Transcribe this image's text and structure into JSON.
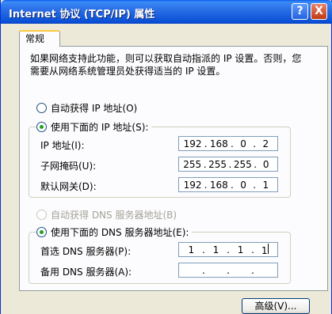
{
  "window": {
    "title": "Internet 协议 (TCP/IP) 属性",
    "help_label": "?",
    "close_label": "X"
  },
  "tabs": [
    {
      "label": "常规"
    }
  ],
  "description": "如果网络支持此功能，则可以获取自动指派的 IP 设置。否则，您需要从网络系统管理员处获得适当的 IP 设置。",
  "ip_mode": {
    "auto_label": "自动获得 IP 地址(O)",
    "manual_label": "使用下面的 IP 地址(S):",
    "selected": "manual"
  },
  "ip_fields": {
    "ip_label": "IP 地址(I):",
    "ip": [
      "192",
      "168",
      "0",
      "2"
    ],
    "mask_label": "子网掩码(U):",
    "mask": [
      "255",
      "255",
      "255",
      "0"
    ],
    "gateway_label": "默认网关(D):",
    "gateway": [
      "192",
      "168",
      "0",
      "1"
    ]
  },
  "dns_mode": {
    "auto_label": "自动获得 DNS 服务器地址(B)",
    "manual_label": "使用下面的 DNS 服务器地址(E):",
    "selected": "manual"
  },
  "dns_fields": {
    "preferred_label": "首选 DNS 服务器(P):",
    "preferred": [
      "1",
      "1",
      "1",
      "1"
    ],
    "alternate_label": "备用 DNS 服务器(A):",
    "alternate": [
      "",
      "",
      "",
      ""
    ]
  },
  "buttons": {
    "advanced_label": "高级(V)..."
  }
}
